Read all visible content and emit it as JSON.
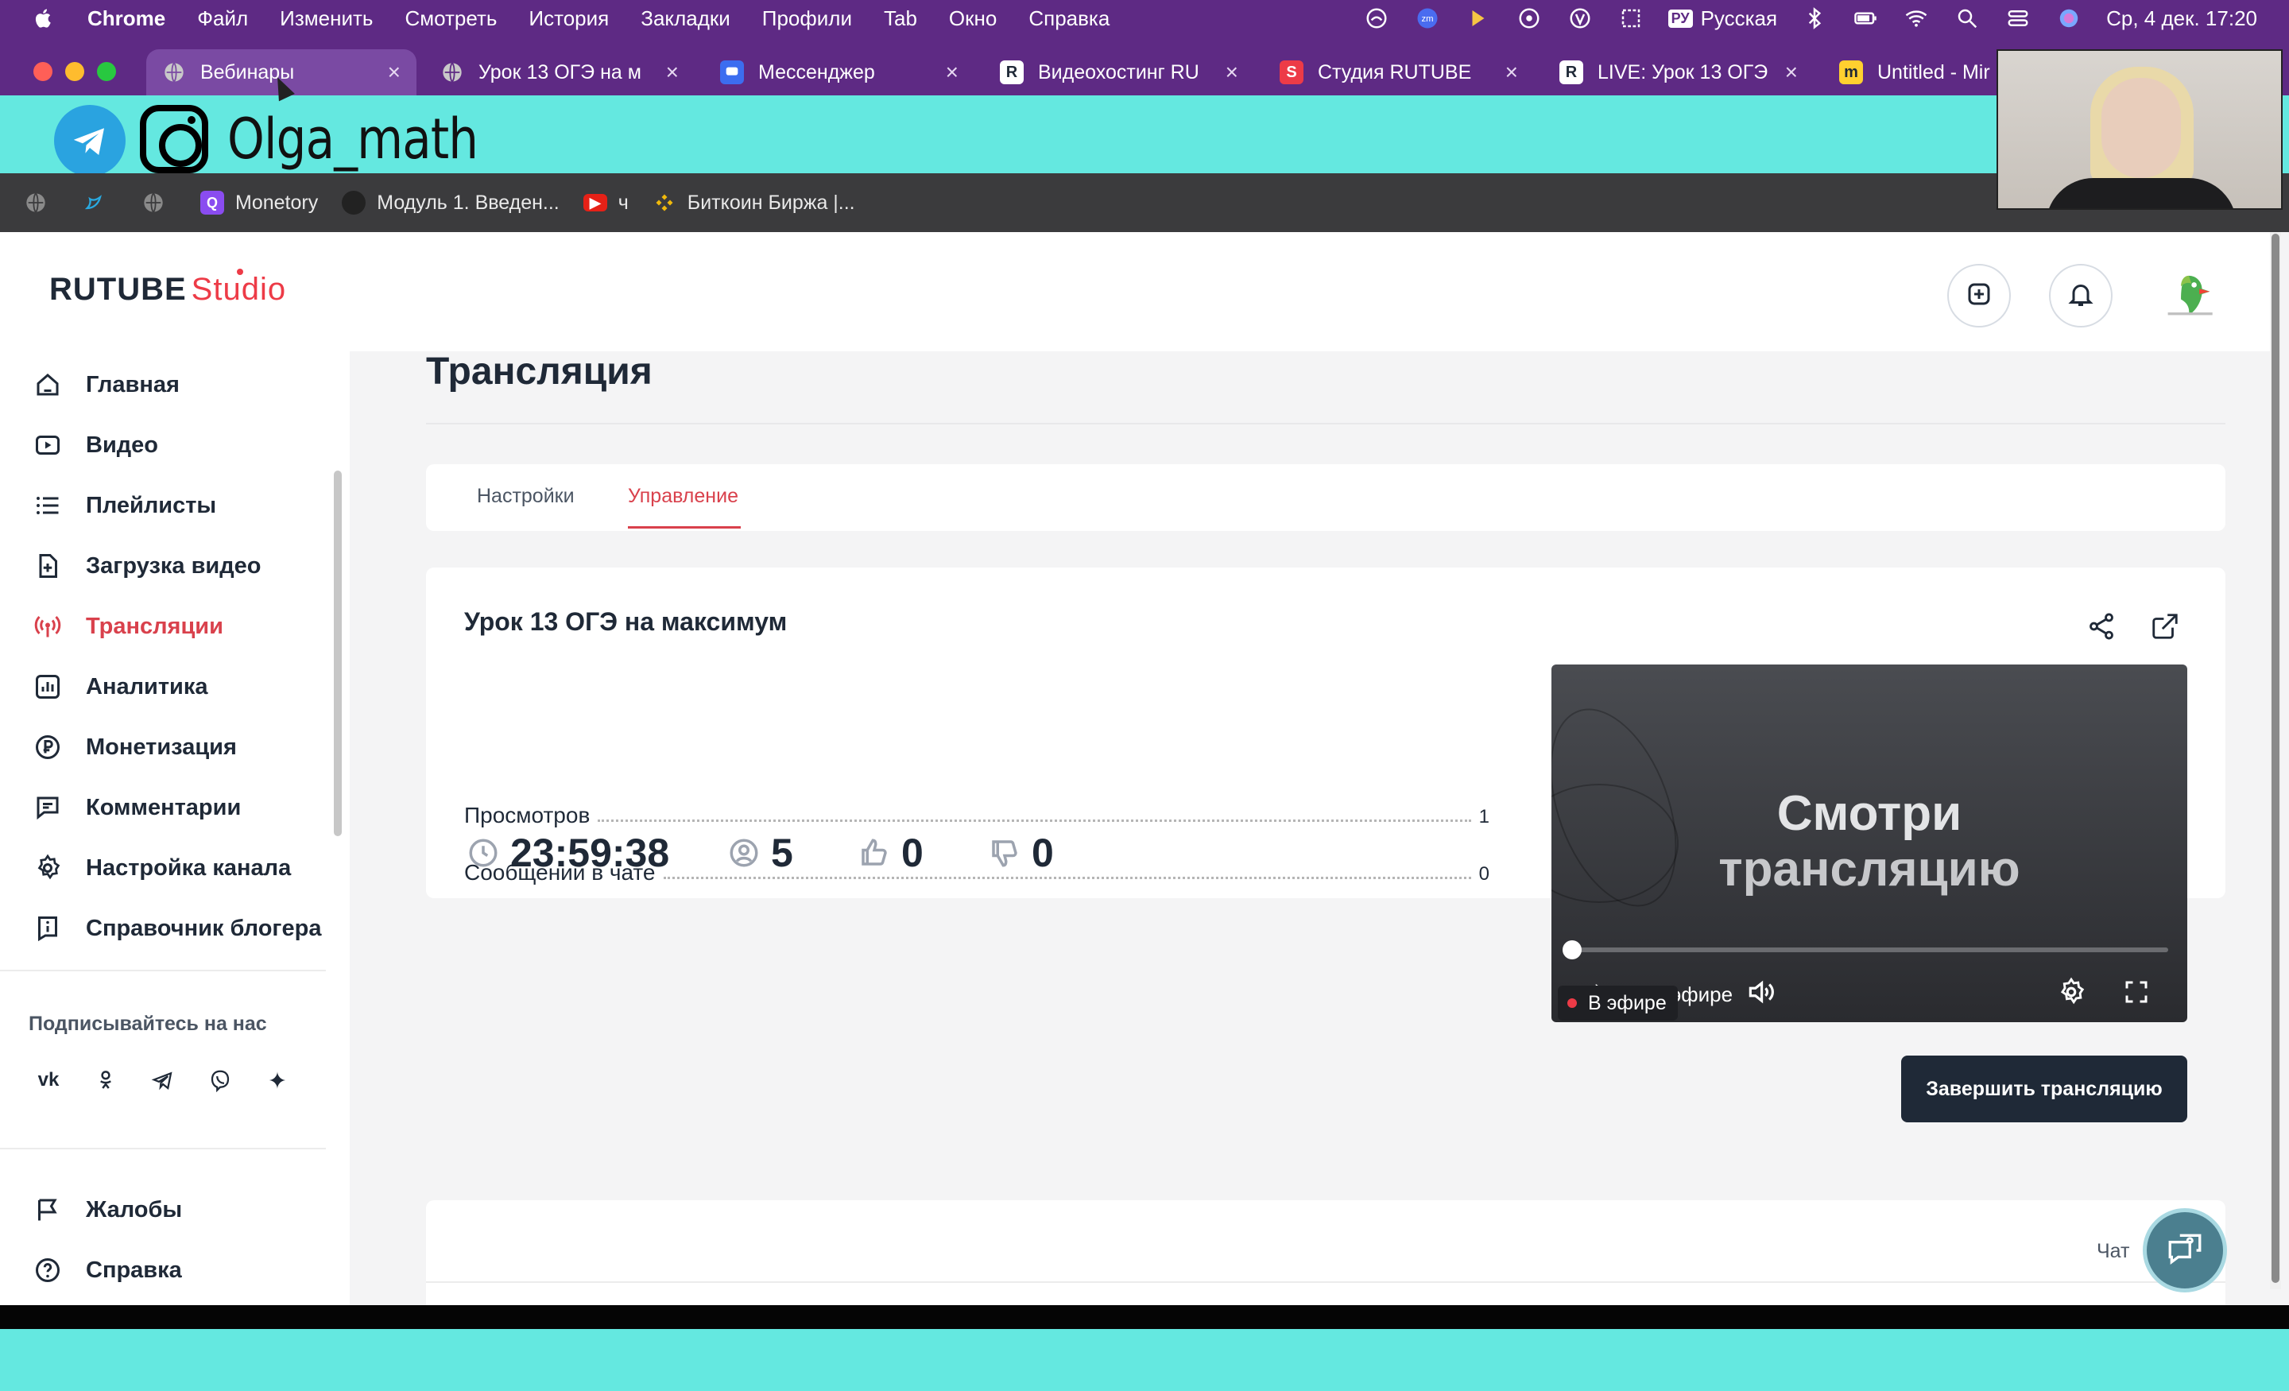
{
  "menubar": {
    "app": "Chrome",
    "items": [
      "Файл",
      "Изменить",
      "Смотреть",
      "История",
      "Закладки",
      "Профили",
      "Tab",
      "Окно",
      "Справка"
    ],
    "language_badge": "РУ",
    "language": "Русская",
    "datetime": "Ср, 4 дек. 17:20"
  },
  "tabs": [
    {
      "title": "Вебинары",
      "icon": "globe-icon"
    },
    {
      "title": "Урок 13 ОГЭ на м",
      "icon": "globe-icon"
    },
    {
      "title": "Мессенджер",
      "icon": "messenger-icon"
    },
    {
      "title": "Видеохостинг RU",
      "icon": "rutube-icon"
    },
    {
      "title": "Студия RUTUBE",
      "icon": "rutube-studio-icon"
    },
    {
      "title": "LIVE: Урок 13 ОГЭ",
      "icon": "rutube-icon"
    },
    {
      "title": "Untitled - Mir",
      "icon": "miro-icon"
    }
  ],
  "banner": {
    "name": "Olga_math"
  },
  "bookmarks": [
    {
      "label": "Monetory",
      "icon": "monetory-icon"
    },
    {
      "label": "Модуль 1. Введен...",
      "icon": "module-icon"
    },
    {
      "label": "ч",
      "icon": "youtube-icon"
    },
    {
      "label": "Биткоин Биржа |...",
      "icon": "binance-icon"
    }
  ],
  "studio": {
    "logo_main": "RUTUBE",
    "logo_sub": "Studio"
  },
  "sidebar": {
    "items": [
      {
        "label": "Главная",
        "icon": "home-icon"
      },
      {
        "label": "Видео",
        "icon": "video-icon"
      },
      {
        "label": "Плейлисты",
        "icon": "playlist-icon"
      },
      {
        "label": "Загрузка видео",
        "icon": "upload-icon"
      },
      {
        "label": "Трансляции",
        "icon": "broadcast-icon",
        "active": true
      },
      {
        "label": "Аналитика",
        "icon": "analytics-icon"
      },
      {
        "label": "Монетизация",
        "icon": "ruble-icon"
      },
      {
        "label": "Комментарии",
        "icon": "comment-icon"
      },
      {
        "label": "Настройка канала",
        "icon": "gear-icon"
      },
      {
        "label": "Справочник блогера",
        "icon": "info-icon"
      }
    ],
    "follow_title": "Подписывайтесь на нас",
    "socials": [
      "vk",
      "ok",
      "telegram",
      "viber",
      "dzen"
    ],
    "bottom_items": [
      {
        "label": "Жалобы",
        "icon": "flag-icon"
      },
      {
        "label": "Справка",
        "icon": "help-icon"
      }
    ]
  },
  "main": {
    "title": "Трансляция",
    "tabs": [
      "Настройки",
      "Управление"
    ],
    "active_tab": "Управление",
    "stream": {
      "title": "Урок 13 ОГЭ на максимум",
      "stats": [
        {
          "label": "Просмотров",
          "value": "1"
        },
        {
          "label": "Сообщений в чате",
          "value": "0"
        }
      ],
      "timer": "23:59:38",
      "viewers": "5",
      "likes": "0",
      "dislikes": "0",
      "player": {
        "line1": "Смотри",
        "line2": "трансляцию",
        "live_label": "В эфире",
        "live_label_partial": "эфире"
      },
      "end_button": "Завершить трансляцию"
    },
    "chat_label": "Чат"
  },
  "colors": {
    "accent": "#d9414c",
    "dark_button": "#1f2937",
    "banner": "#64e8e0",
    "chrome_frame": "#5e2a84"
  }
}
